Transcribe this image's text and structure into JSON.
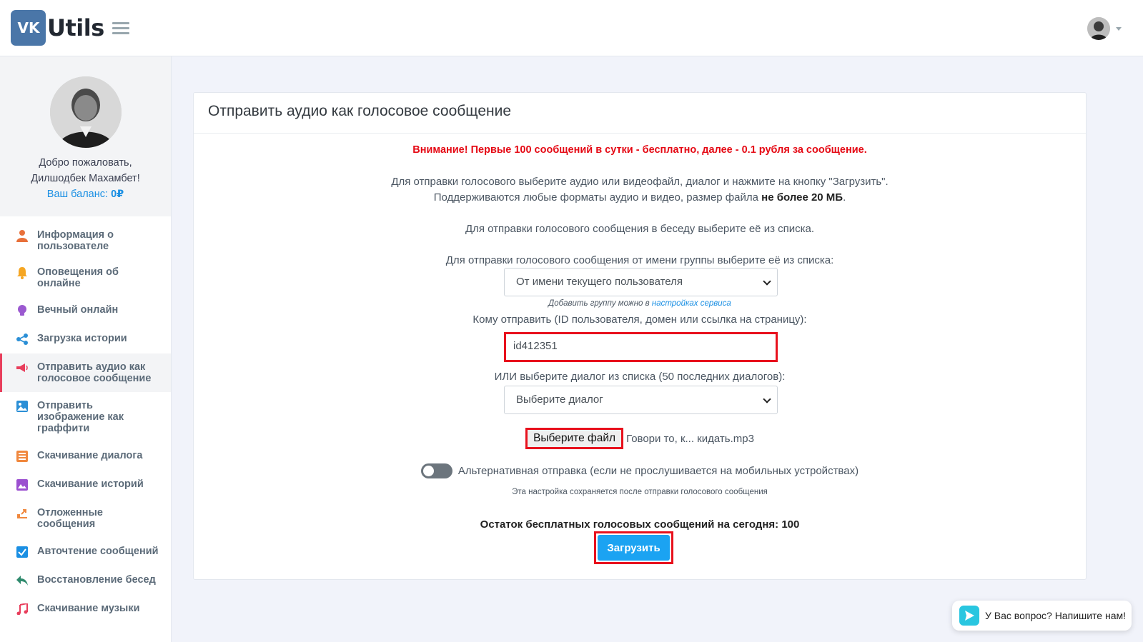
{
  "header": {
    "logo_badge": "VK",
    "logo_text": "Utils"
  },
  "sidebar": {
    "welcome_line1": "Добро пожаловать,",
    "welcome_line2": "Дилшодбек Махамбет!",
    "balance_label": "Ваш баланс:",
    "balance_value": "0₽",
    "items": [
      {
        "label": "Информация о пользователе",
        "icon": "user-icon",
        "color": "#e8703a"
      },
      {
        "label": "Оповещения об онлайне",
        "icon": "bell-icon",
        "color": "#f5a623"
      },
      {
        "label": "Вечный онлайн",
        "icon": "lightbulb-icon",
        "color": "#9b59d0"
      },
      {
        "label": "Загрузка истории",
        "icon": "share-icon",
        "color": "#2b8fd6"
      },
      {
        "label": "Отправить аудио как голосовое сообщение",
        "icon": "megaphone-icon",
        "color": "#e83e5c",
        "active": true
      },
      {
        "label": "Отправить изображение как граффити",
        "icon": "image-icon",
        "color": "#2b8fd6"
      },
      {
        "label": "Скачивание диалога",
        "icon": "list-icon",
        "color": "#f0883e"
      },
      {
        "label": "Скачивание историй",
        "icon": "picture-icon",
        "color": "#9b4fd0"
      },
      {
        "label": "Отложенные сообщения",
        "icon": "schedule-icon",
        "color": "#f0883e"
      },
      {
        "label": "Авточтение сообщений",
        "icon": "checkbox-icon",
        "color": "#1a8fe3"
      },
      {
        "label": "Восстановление бесед",
        "icon": "reply-icon",
        "color": "#2f8a6d"
      },
      {
        "label": "Скачивание музыки",
        "icon": "music-icon",
        "color": "#e83e5c"
      }
    ]
  },
  "main": {
    "title": "Отправить аудио как голосовое сообщение",
    "warning": "Внимание! Первые 100 сообщений в сутки - бесплатно, далее - 0.1 рубля за сообщение.",
    "info_line1": "Для отправки голосового выберите аудио или видеофайл, диалог и нажмите на кнопку \"Загрузить\".",
    "info_line2_prefix": "Поддерживаются любые форматы аудио и видео, размер файла",
    "info_line2_bold": "не более 20 МБ",
    "info_line2_suffix": ".",
    "chat_hint": "Для отправки голосового сообщения в беседу выберите её из списка.",
    "group_label": "Для отправки голосового сообщения от имени группы выберите её из списка:",
    "group_select_value": "От имени текущего пользователя",
    "group_hint_prefix": "Добавить группу можно в",
    "group_hint_link": "настройках сервиса",
    "recipient_label": "Кому отправить (ID пользователя, домен или ссылка на страницу):",
    "recipient_value": "id412351",
    "dialog_label": "ИЛИ выберите диалог из списка (50 последних диалогов):",
    "dialog_select_value": "Выберите диалог",
    "file_button": "Выберите файл",
    "file_name": "Говори то, к... кидать.mp3",
    "toggle_label": "Альтернативная отправка (если не прослушивается на мобильных устройствах)",
    "toggle_on": false,
    "toggle_note": "Эта настройка сохраняется после отправки голосового сообщения",
    "remaining_label": "Остаток бесплатных голосовых сообщений на сегодня:",
    "remaining_value": "100",
    "submit_label": "Загрузить"
  },
  "chat_widget": {
    "label": "У Вас вопрос? Напишите нам!"
  },
  "colors": {
    "accent": "#1ba3f2",
    "warning": "#e50914",
    "highlight_border": "#e8111d",
    "vk_blue": "#4a76a8"
  }
}
